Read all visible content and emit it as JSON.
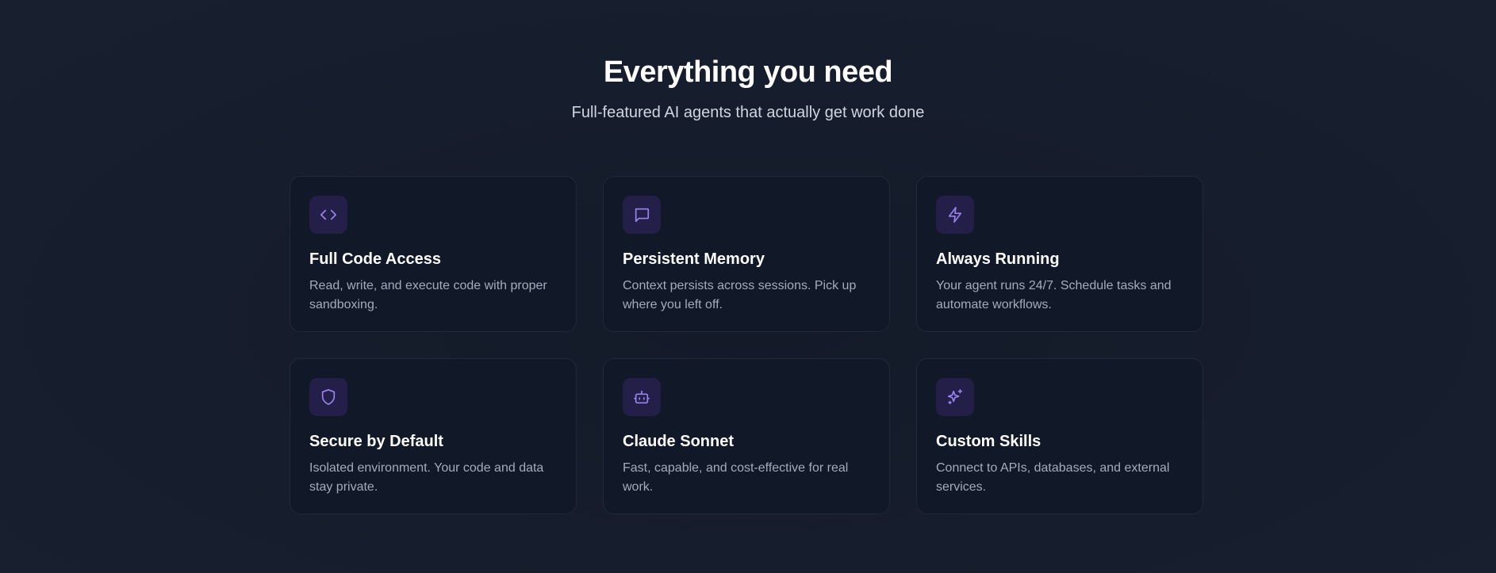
{
  "section": {
    "title": "Everything you need",
    "subtitle": "Full-featured AI agents that actually get work done"
  },
  "features": [
    {
      "icon": "code-icon",
      "title": "Full Code Access",
      "description": "Read, write, and execute code with proper sandboxing."
    },
    {
      "icon": "message-icon",
      "title": "Persistent Memory",
      "description": "Context persists across sessions. Pick up where you left off."
    },
    {
      "icon": "lightning-icon",
      "title": "Always Running",
      "description": "Your agent runs 24/7. Schedule tasks and automate workflows."
    },
    {
      "icon": "shield-icon",
      "title": "Secure by Default",
      "description": "Isolated environment. Your code and data stay private."
    },
    {
      "icon": "robot-icon",
      "title": "Claude Sonnet",
      "description": "Fast, capable, and cost-effective for real work."
    },
    {
      "icon": "sparkles-icon",
      "title": "Custom Skills",
      "description": "Connect to APIs, databases, and external services."
    }
  ],
  "colors": {
    "background": "#161d2c",
    "card_background": "#111827",
    "card_border": "#1f2a3a",
    "icon_box": "#231f48",
    "icon_accent": "#9b82f0"
  }
}
